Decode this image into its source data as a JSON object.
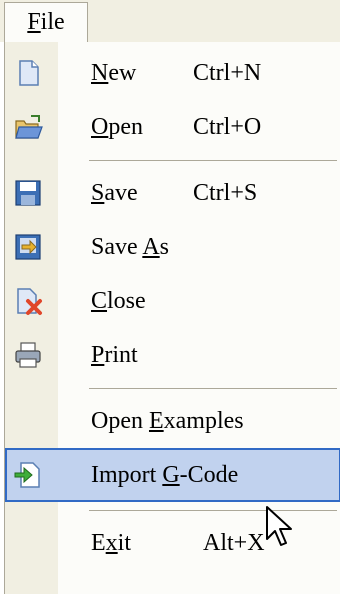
{
  "menubar": {
    "file_label": "File",
    "file_mnemonic": "F",
    "file_rest": "ile"
  },
  "items": [
    {
      "pre": "",
      "mn": "N",
      "post": "ew",
      "shortcut": "Ctrl+N",
      "icon": "new-file-icon"
    },
    {
      "pre": "",
      "mn": "O",
      "post": "pen",
      "shortcut": "Ctrl+O",
      "icon": "open-folder-icon"
    },
    {
      "pre": "",
      "mn": "S",
      "post": "ave",
      "shortcut": "Ctrl+S",
      "icon": "save-disk-icon"
    },
    {
      "pre": "Save ",
      "mn": "A",
      "post": "s",
      "shortcut": "",
      "icon": "save-as-icon"
    },
    {
      "pre": "",
      "mn": "C",
      "post": "lose",
      "shortcut": "",
      "icon": "close-file-icon"
    },
    {
      "pre": "",
      "mn": "P",
      "post": "rint",
      "shortcut": "",
      "icon": "printer-icon"
    },
    {
      "pre": "Open ",
      "mn": "E",
      "post": "xamples",
      "shortcut": "",
      "icon": ""
    },
    {
      "pre": "Import ",
      "mn": "G",
      "post": "-Code",
      "shortcut": "",
      "icon": "import-icon"
    },
    {
      "pre": "E",
      "mn": "x",
      "post": "it",
      "shortcut": "Alt+X",
      "icon": ""
    }
  ],
  "colors": {
    "highlight_bg": "#c1d2ee",
    "highlight_border": "#316ac5",
    "gutter": "#f1efe2",
    "menu_bg": "#fcfcf9"
  }
}
